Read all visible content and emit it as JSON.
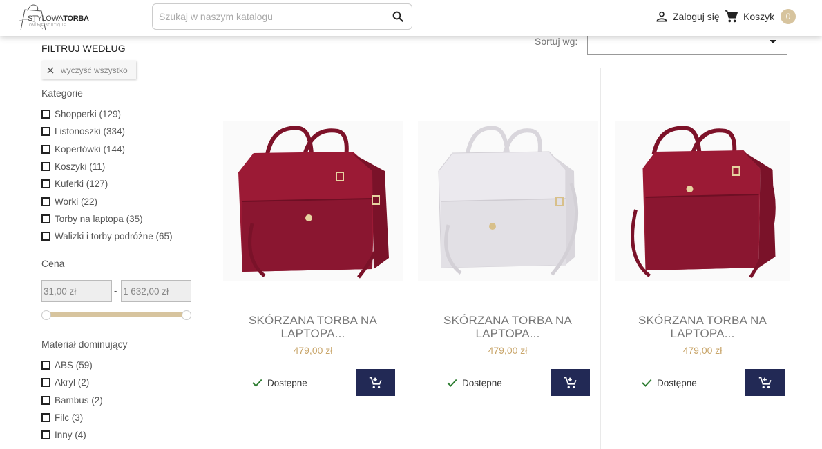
{
  "header": {
    "logo": {
      "brand_light": "STYLOWA",
      "brand_bold": "TORBA",
      "tagline": "ONLINE BOUTIQUE"
    },
    "search": {
      "placeholder": "Szukaj w naszym katalogu",
      "icon": "search-icon"
    },
    "login_label": "Zaloguj się",
    "cart_label": "Koszyk",
    "cart_count": "0",
    "accent_color": "#d7c49e"
  },
  "sidebar": {
    "filter_title": "FILTRUJ WEDŁUG",
    "clear_all": "wyczyść wszystko",
    "categories": {
      "title": "Kategorie",
      "items": [
        {
          "label": "Shopperki (129)"
        },
        {
          "label": "Listonoszki (334)"
        },
        {
          "label": "Kopertówki (144)"
        },
        {
          "label": "Koszyki (11)"
        },
        {
          "label": "Kuferki (127)"
        },
        {
          "label": "Worki (22)"
        },
        {
          "label": "Torby na laptopa (35)"
        },
        {
          "label": "Walizki i torby podróżne (65)"
        }
      ]
    },
    "price": {
      "title": "Cena",
      "min": "31,00 zł",
      "max": "1 632,00 zł",
      "separator": "-"
    },
    "material": {
      "title": "Materiał dominujący",
      "items": [
        {
          "label": "ABS (59)"
        },
        {
          "label": "Akryl (2)"
        },
        {
          "label": "Bambus (2)"
        },
        {
          "label": "Filc (3)"
        },
        {
          "label": "Inny (4)"
        }
      ]
    }
  },
  "sort": {
    "label": "Sortuj wg:",
    "selected": ""
  },
  "products": [
    {
      "name": "SKÓRZANA TORBA NA LAPTOPA...",
      "price": "479,00 zł",
      "availability": "Dostępne",
      "color": "#9b1a35"
    },
    {
      "name": "SKÓRZANA TORBA NA LAPTOPA...",
      "price": "479,00 zł",
      "availability": "Dostępne",
      "color": "#e9e7ec"
    },
    {
      "name": "SKÓRZANA TORBA NA LAPTOPA...",
      "price": "479,00 zł",
      "availability": "Dostępne",
      "color": "#9b1a35"
    }
  ],
  "colors": {
    "button": "#222955",
    "price": "#c9a66b",
    "available": "#2e7d32"
  }
}
